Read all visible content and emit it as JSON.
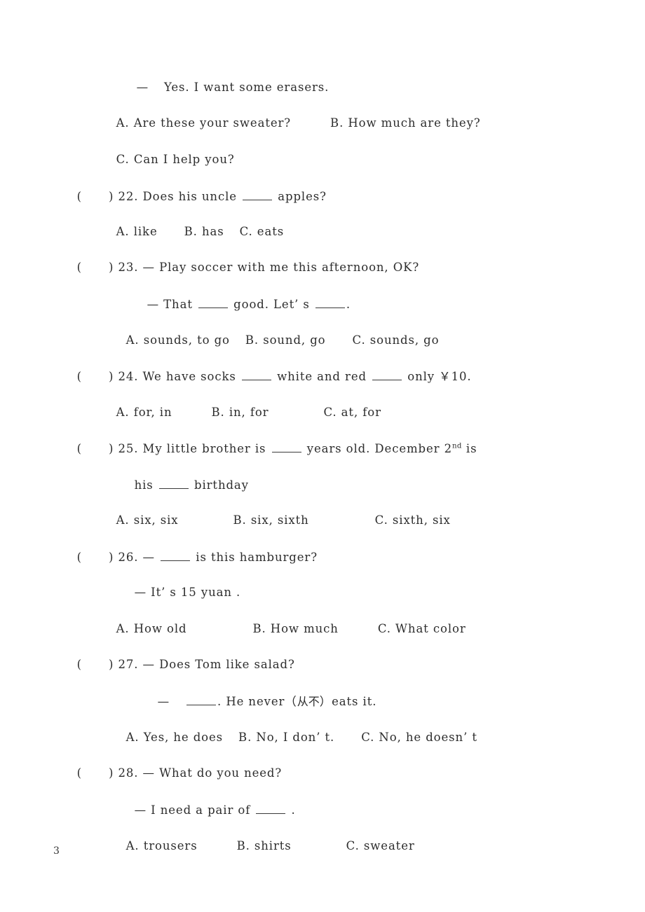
{
  "document": {
    "type": "exam-paper",
    "subject_language": "English",
    "page_number": "3",
    "background_color": "#ffffff",
    "text_color": "#2d2d2d"
  },
  "q21_continued": {
    "reply_dash": "—",
    "reply_text": "Yes. I want some erasers.",
    "option_a": "A. Are these your sweater?",
    "option_b": "B. How much are they?",
    "option_c": "C. Can I help you?"
  },
  "questions": [
    {
      "marker_open": "(",
      "marker_close": ")",
      "number": "22.",
      "stem_before": "Does his uncle",
      "stem_after": "apples?",
      "options_line": "A. like      B. has     C. eats",
      "option_a": "A. like",
      "option_b": "B. has",
      "option_c": "C. eats"
    },
    {
      "marker_open": "(",
      "marker_close": ")",
      "number": "23.",
      "dash": "—",
      "stem": "Play soccer with me this afternoon, OK?",
      "reply_dash": "—",
      "reply_before": "That",
      "reply_middle": "good. Let’ s",
      "reply_after": ".",
      "option_a": "A. sounds, to go",
      "option_b": "B. sound, go",
      "option_c": "C. sounds, go"
    },
    {
      "marker_open": "(",
      "marker_close": ")",
      "number": "24.",
      "stem_part1": "We have socks",
      "stem_part2": "white and red",
      "stem_part3": "only ￥10.",
      "option_a": "A. for, in",
      "option_b": "B. in, for",
      "option_c": "C. at, for"
    },
    {
      "marker_open": "(",
      "marker_close": ")",
      "number": "25.",
      "stem_part1": "My little brother is",
      "stem_part2": "years old. December 2",
      "stem_superscript": "nd",
      "stem_part3": "is",
      "stem_line2_before": "his",
      "stem_line2_after": "birthday",
      "option_a": "A. six, six",
      "option_b": "B. six, sixth",
      "option_c": "C. sixth, six"
    },
    {
      "marker_open": "(",
      "marker_close": ")",
      "number": "26.",
      "dash": "—",
      "stem_after": "is this hamburger?",
      "reply_dash": "—",
      "reply_text": "It’ s 15 yuan .",
      "option_a": "A. How old",
      "option_b": "B. How much",
      "option_c": "C. What color"
    },
    {
      "marker_open": "(",
      "marker_close": ")",
      "number": "27.",
      "dash": "—",
      "stem": "Does Tom like salad?",
      "reply_dash": "—",
      "reply_before": ".",
      "reply_after_1": "He never（",
      "reply_cjk": "从不",
      "reply_after_2": "）eats it.",
      "option_a": "A. Yes, he does",
      "option_b": "B. No, I don’ t.",
      "option_c": "C. No, he doesn’ t"
    },
    {
      "marker_open": "(",
      "marker_close": ")",
      "number": "28.",
      "dash": "—",
      "stem": "What do you need?",
      "reply_dash": "—",
      "reply_before": "I need a pair of",
      "reply_after": ".",
      "option_a": "A. trousers",
      "option_b": "B. shirts",
      "option_c": "C. sweater"
    }
  ]
}
